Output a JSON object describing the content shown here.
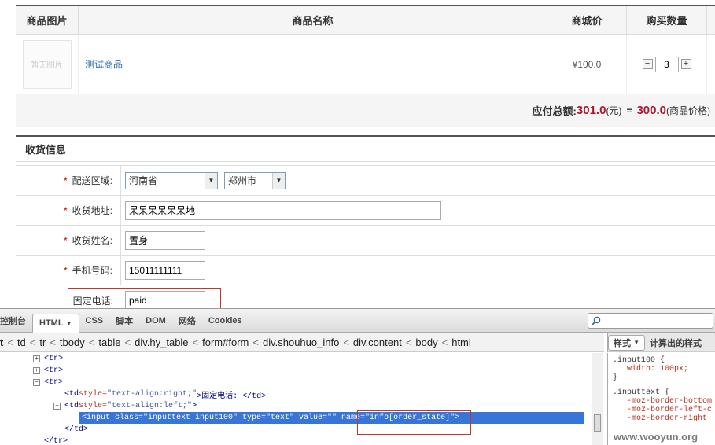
{
  "cart": {
    "headers": [
      "商品图片",
      "商品名称",
      "商城价",
      "购买数量"
    ],
    "item": {
      "image_placeholder": "暂无图片",
      "name": "测试商品",
      "price": "¥100.0",
      "qty_minus": "−",
      "quantity": "3",
      "qty_plus": "+"
    },
    "total_label": "应付总额:",
    "total_amount": "301.0",
    "total_unit": "(元)",
    "equals": "=",
    "goods_amount": "300.0",
    "goods_label": "(商品价格)"
  },
  "shipping": {
    "section_title": "收货信息",
    "required_mark": "*",
    "region_label": "配送区域:",
    "province": "河南省",
    "city": "郑州市",
    "address_label": "收货地址:",
    "address": "呆呆呆呆呆呆地",
    "name_label": "收货姓名:",
    "name": "置身",
    "mobile_label": "手机号码:",
    "mobile": "15011111111",
    "phone_label": "固定电话:",
    "phone": "paid"
  },
  "firebug": {
    "tabs": [
      "控制台",
      "HTML",
      "CSS",
      "脚本",
      "DOM",
      "网络",
      "Cookies"
    ],
    "html_dropdown": "▼",
    "breadcrumb": [
      "t",
      "td",
      "tr",
      "tbody",
      "table",
      "div.hy_table",
      "form#form",
      "div.shouhuo_info",
      "div.content",
      "body",
      "html"
    ],
    "side_tabs": [
      "样式",
      "计算出的样式"
    ],
    "tree": {
      "tr1": "<tr>",
      "tr2": "<tr>",
      "tr3": "<tr>",
      "td1_open": "<td ",
      "td1_attr": "style=",
      "td1_val": "\"text-align:right;\"",
      "td1_text": ">固定电话: </td>",
      "td2_open": "<td ",
      "td2_attr": "style=",
      "td2_val": "\"text-align:left;\"",
      "td2_close": ">",
      "input_line": "<input class=\"inputtext input100\" type=\"text\" value=\"\" name=\"info[order_state]\">",
      "td_end": "</td>",
      "tr_end": "</tr>"
    },
    "css": {
      "rule1_selector": ".input100 {",
      "rule1_prop": "width: 100px;",
      "rule1_close": "}",
      "rule2_selector": ".inputtext {",
      "rule2_p1": "-moz-border-bottom",
      "rule2_p2": "-moz-border-left-c",
      "rule2_p3": "-moz-border-right"
    }
  },
  "watermark": "www.wooyun.org"
}
